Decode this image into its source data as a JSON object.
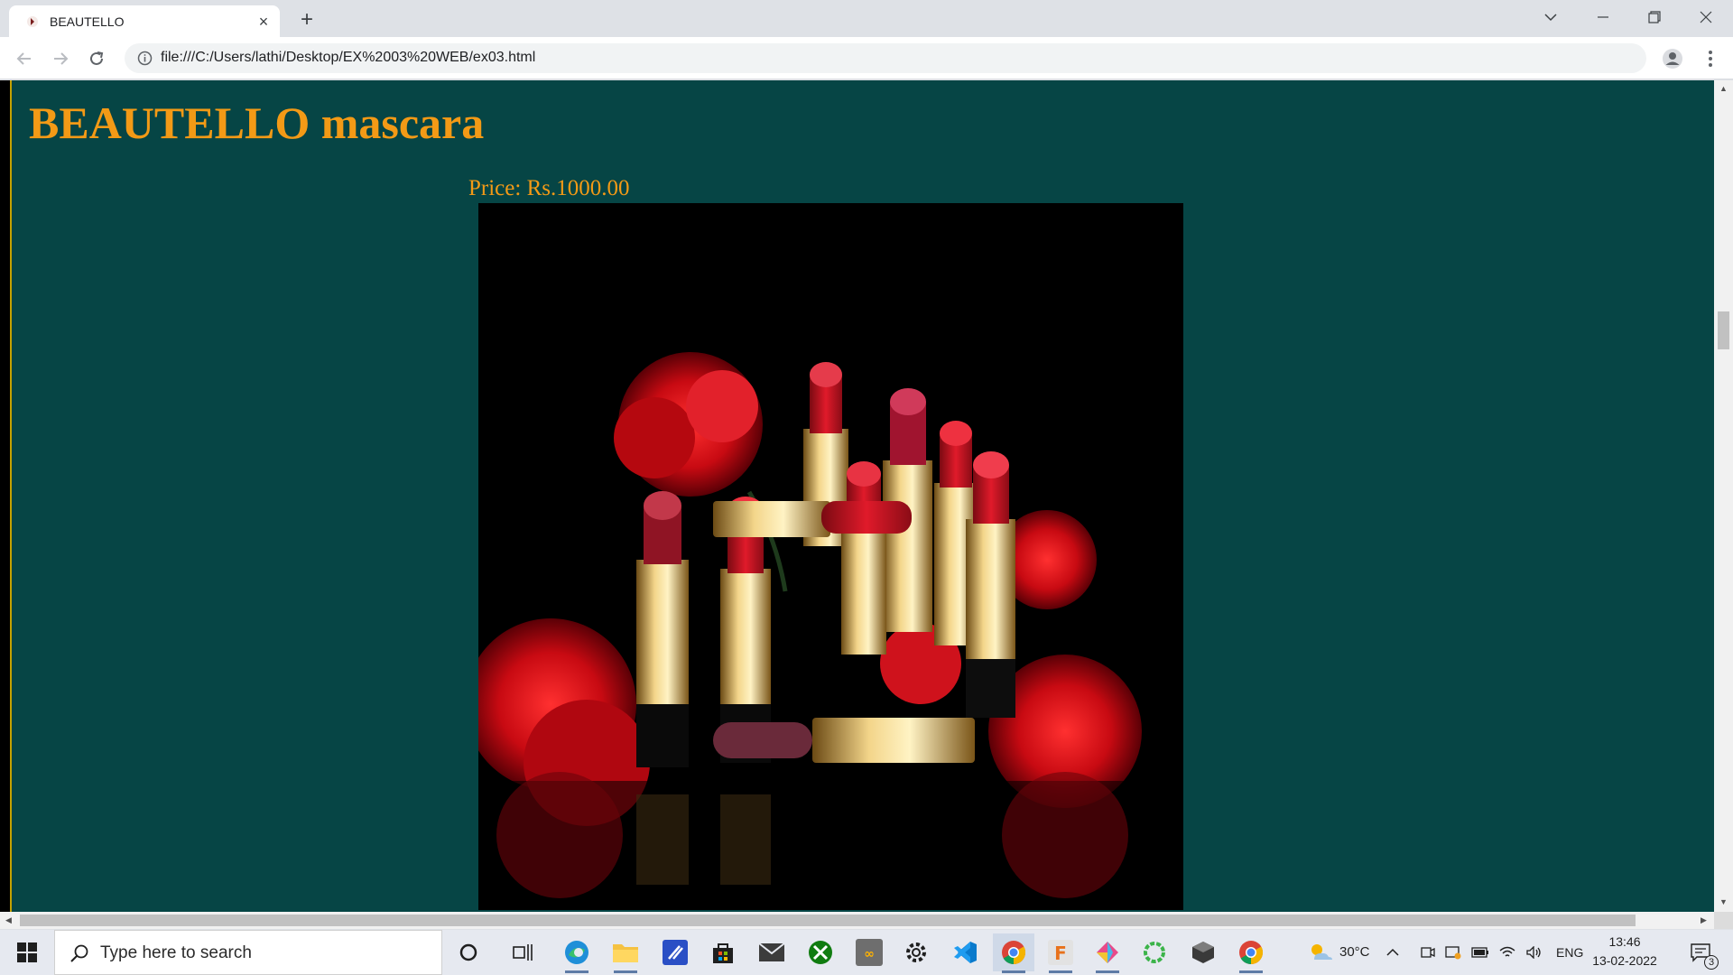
{
  "browser": {
    "tab_title": "BEAUTELLO",
    "url": "file:///C:/Users/lathi/Desktop/EX%2003%20WEB/ex03.html"
  },
  "page": {
    "heading": "BEAUTELLO mascara",
    "price": "Price: Rs.1000.00",
    "image_alt": "Lipsticks with red carnations"
  },
  "taskbar": {
    "search_placeholder": "Type here to search",
    "weather": "30°C",
    "language": "ENG",
    "time": "13:46",
    "date": "13-02-2022",
    "notification_count": "3"
  },
  "colors": {
    "page_background": "#064545",
    "heading_color": "#f39a16",
    "price_color": "#f39a16"
  }
}
